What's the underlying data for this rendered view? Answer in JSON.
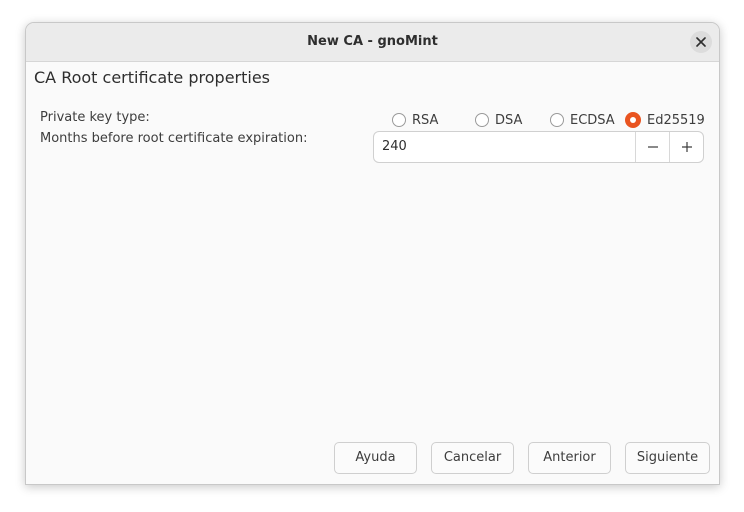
{
  "window": {
    "title": "New CA - gnoMint"
  },
  "page": {
    "heading": "CA Root certificate properties"
  },
  "key_type": {
    "label": "Private key type:",
    "options": [
      "RSA",
      "DSA",
      "ECDSA",
      "Ed25519"
    ],
    "selected": "Ed25519"
  },
  "expiration": {
    "label": "Months before root certificate expiration:",
    "value": "240"
  },
  "buttons": {
    "help": "Ayuda",
    "cancel": "Cancelar",
    "back": "Anterior",
    "next": "Siguiente"
  },
  "colors": {
    "accent": "#e95420"
  },
  "icons": {
    "close": "close-icon",
    "decrement": "minus-icon",
    "increment": "plus-icon"
  }
}
